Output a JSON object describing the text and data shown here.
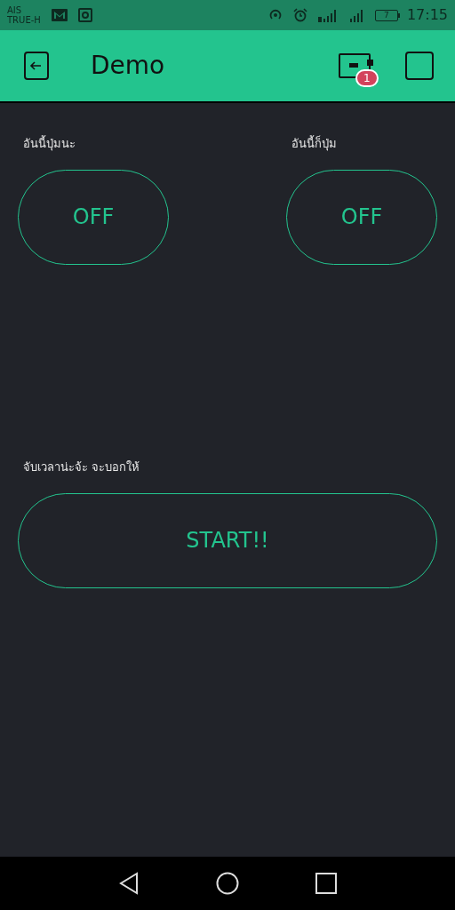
{
  "status_bar": {
    "carriers": [
      "AIS",
      "TRUE-H"
    ],
    "battery": "7",
    "time": "17:15"
  },
  "app_bar": {
    "title": "Demo",
    "badge": "1"
  },
  "widgets": [
    {
      "kind": "button",
      "label": "อันนี้ปุ่มนะ",
      "text": "OFF",
      "on": false
    },
    {
      "kind": "button",
      "label": "อันนี้ก็ปุ่ม",
      "text": "OFF",
      "on": false
    },
    {
      "kind": "wide_button",
      "label": "จับเวลาน่ะจ้ะ จะบอกให้",
      "text": "START!!",
      "on": false
    }
  ]
}
